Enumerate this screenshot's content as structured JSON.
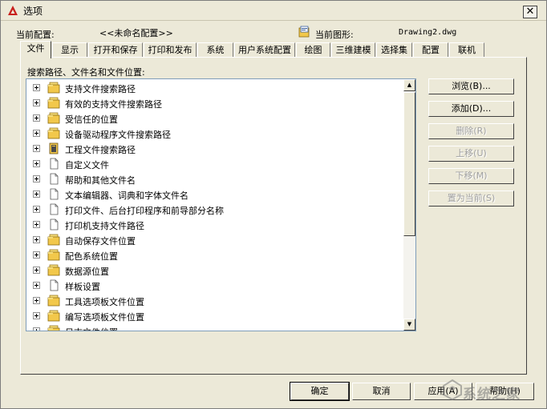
{
  "window": {
    "title": "选项",
    "close_symbol": "✕"
  },
  "profile": {
    "label": "当前配置:",
    "value": "<<未命名配置>>"
  },
  "drawing": {
    "label": "当前图形:",
    "value": "Drawing2.dwg"
  },
  "tabs": [
    {
      "label": "文件",
      "active": true
    },
    {
      "label": "显示"
    },
    {
      "label": "打开和保存"
    },
    {
      "label": "打印和发布"
    },
    {
      "label": "系统"
    },
    {
      "label": "用户系统配置"
    },
    {
      "label": "绘图"
    },
    {
      "label": "三维建模"
    },
    {
      "label": "选择集"
    },
    {
      "label": "配置"
    },
    {
      "label": "联机"
    }
  ],
  "section_label": "搜索路径、文件名和文件位置:",
  "tree_items": [
    {
      "label": "支持文件搜索路径",
      "icon": "folder-stack-icon"
    },
    {
      "label": "有效的支持文件搜索路径",
      "icon": "folder-stack-icon"
    },
    {
      "label": "受信任的位置",
      "icon": "folder-stack-icon"
    },
    {
      "label": "设备驱动程序文件搜索路径",
      "icon": "folder-stack-icon"
    },
    {
      "label": "工程文件搜索路径",
      "icon": "project-book-icon"
    },
    {
      "label": "自定义文件",
      "icon": "document-icon"
    },
    {
      "label": "帮助和其他文件名",
      "icon": "document-icon"
    },
    {
      "label": "文本编辑器、词典和字体文件名",
      "icon": "document-icon"
    },
    {
      "label": "打印文件、后台打印程序和前导部分名称",
      "icon": "document-icon"
    },
    {
      "label": "打印机支持文件路径",
      "icon": "document-icon"
    },
    {
      "label": "自动保存文件位置",
      "icon": "folder-stack-icon"
    },
    {
      "label": "配色系统位置",
      "icon": "folder-stack-icon"
    },
    {
      "label": "数据源位置",
      "icon": "folder-stack-icon"
    },
    {
      "label": "样板设置",
      "icon": "document-icon"
    },
    {
      "label": "工具选项板文件位置",
      "icon": "folder-stack-icon"
    },
    {
      "label": "编写选项板文件位置",
      "icon": "folder-stack-icon"
    },
    {
      "label": "日志文件位置",
      "icon": "folder-stack-icon"
    }
  ],
  "side_buttons": {
    "browse": "浏览(B)...",
    "add": "添加(D)...",
    "remove": "删除(R)",
    "move_up": "上移(U)",
    "move_down": "下移(M)",
    "set_current": "置为当前(S)"
  },
  "bottom_buttons": {
    "ok": "确定",
    "cancel": "取消",
    "apply": "应用(A)",
    "help": "帮助(H)"
  },
  "watermark": {
    "text": "系统之家"
  },
  "colors": {
    "dialog_bg": "#ece9d8",
    "folder_yellow": "#f2c84b",
    "app_red": "#c8201c"
  }
}
